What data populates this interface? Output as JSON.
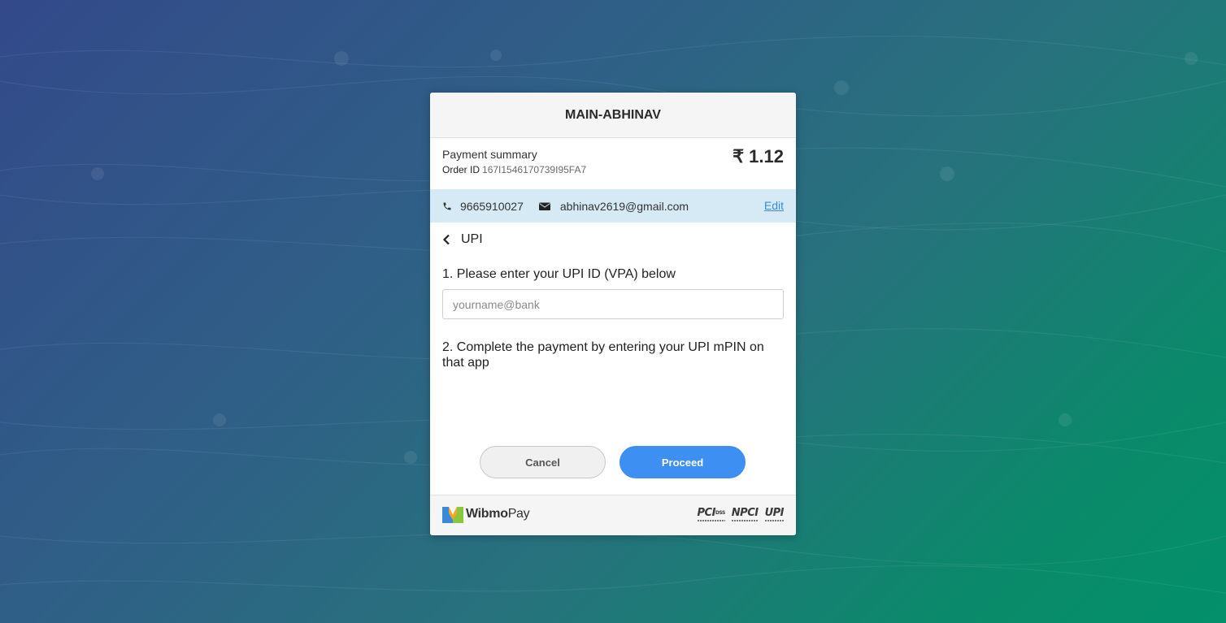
{
  "merchant": {
    "name": "MAIN-ABHINAV"
  },
  "summary": {
    "title": "Payment summary",
    "order_label": "Order ID",
    "order_id": "167I1546170739I95FA7",
    "amount": "₹ 1.12"
  },
  "contact": {
    "phone": "9665910027",
    "email": "abhinav2619@gmail.com",
    "edit_label": "Edit",
    "phone_icon": "phone-icon",
    "email_icon": "envelope-icon"
  },
  "method": {
    "back_icon": "chevron-left-icon",
    "label": "UPI"
  },
  "form": {
    "step1": "1. Please enter your UPI ID (VPA) below",
    "upi_placeholder": "yourname@bank",
    "upi_value": "",
    "step2": "2. Complete the payment by entering your UPI mPIN on that app"
  },
  "actions": {
    "cancel_label": "Cancel",
    "proceed_label": "Proceed"
  },
  "footer": {
    "brand_bold": "Wibmo",
    "brand_light": "Pay",
    "badges": [
      "PCI",
      "DSS",
      "NPCI",
      "UPI"
    ]
  },
  "colors": {
    "accent": "#3d8ff2",
    "link": "#3a8bd8",
    "contact_bar": "#d6eaf5"
  }
}
